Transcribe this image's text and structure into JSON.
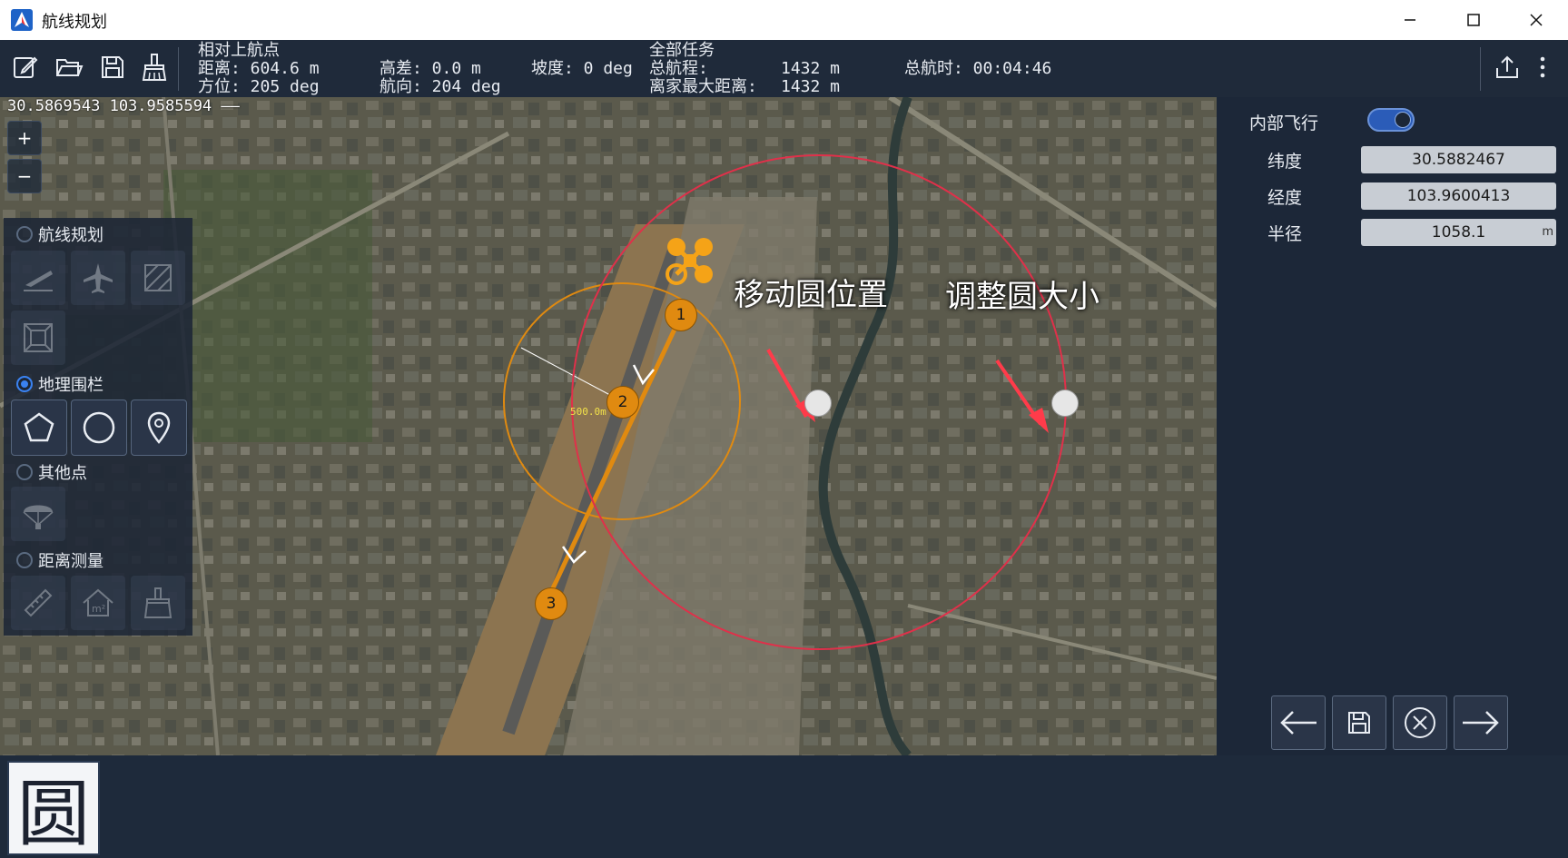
{
  "window": {
    "title": "航线规划"
  },
  "toolbar": {
    "info": {
      "relative_header": "相对上航点",
      "distance": "距离: 604.6 m",
      "bearing": "方位: 205 deg",
      "height_diff": "高差: 0.0 m",
      "heading": "航向: 204 deg",
      "slope": "坡度: 0 deg",
      "all_header": "全部任务",
      "total_range_label": "总航程:",
      "total_range_value": "1432 m",
      "max_home_dist_label": "离家最大距离:",
      "max_home_dist_value": "1432 m",
      "total_time": "总航时: 00:04:46"
    },
    "icons": [
      "edit-icon",
      "folder-open-icon",
      "save-icon",
      "broom-icon",
      "upload-icon",
      "more-vert-icon"
    ]
  },
  "map": {
    "coord_readout": "30.5869543 103.9585594 ––",
    "zoom_in": "+",
    "zoom_out": "−",
    "waypoints": [
      "1",
      "2",
      "3"
    ],
    "radius_label": "500.0m",
    "annotations": {
      "move": "移动圆位置",
      "resize": "调整圆大小"
    }
  },
  "tools": {
    "route_planning": "航线规划",
    "geofence": "地理围栏",
    "other_points": "其他点",
    "distance_measure": "距离测量"
  },
  "right_panel": {
    "internal_flight": "内部飞行",
    "internal_flight_on": true,
    "latitude_label": "纬度",
    "latitude_value": "30.5882467",
    "longitude_label": "经度",
    "longitude_value": "103.9600413",
    "radius_label": "半径",
    "radius_value": "1058.1",
    "radius_unit": "m"
  },
  "bottom": {
    "mode_badge": "圆"
  }
}
